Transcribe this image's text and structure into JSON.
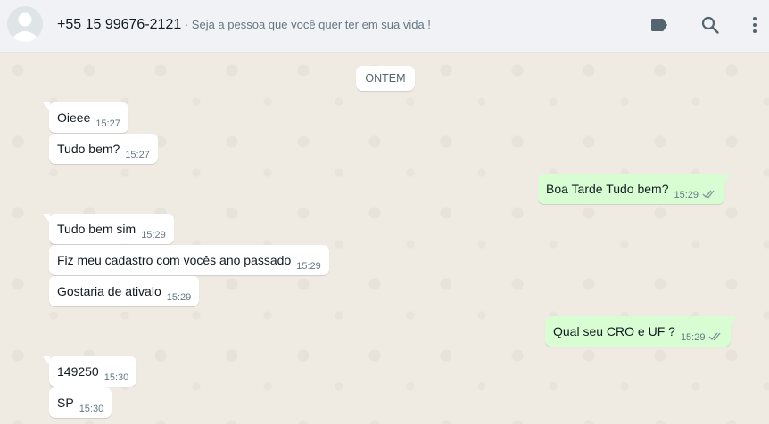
{
  "header": {
    "phone": "+55 15 99676-2121",
    "status": " · Seja a pessoa que você quer ter em sua vida !",
    "icons": [
      "label-icon",
      "search-icon",
      "menu-icon"
    ]
  },
  "chat": {
    "date_chip": "ONTEM",
    "messages": [
      {
        "dir": "in",
        "text": "Oieee",
        "time": "15:27"
      },
      {
        "dir": "in",
        "text": "Tudo bem?",
        "time": "15:27"
      },
      {
        "dir": "out",
        "text": "Boa Tarde Tudo bem?",
        "time": "15:29"
      },
      {
        "dir": "in",
        "text": "Tudo bem sim",
        "time": "15:29"
      },
      {
        "dir": "in",
        "text": "Fiz meu cadastro com vocês ano passado",
        "time": "15:29"
      },
      {
        "dir": "in",
        "text": "Gostaria de ativalo",
        "time": "15:29"
      },
      {
        "dir": "out",
        "text": "Qual seu CRO e UF ?",
        "time": "15:29"
      },
      {
        "dir": "in",
        "text": "149250",
        "time": "15:30"
      },
      {
        "dir": "in",
        "text": "SP",
        "time": "15:30"
      }
    ]
  },
  "colors": {
    "incoming_bubble": "#ffffff",
    "outgoing_bubble": "#d9fdd3",
    "chat_background": "#efeae2",
    "header_background": "#f0f2f5",
    "read_ticks": "#8696a0"
  }
}
